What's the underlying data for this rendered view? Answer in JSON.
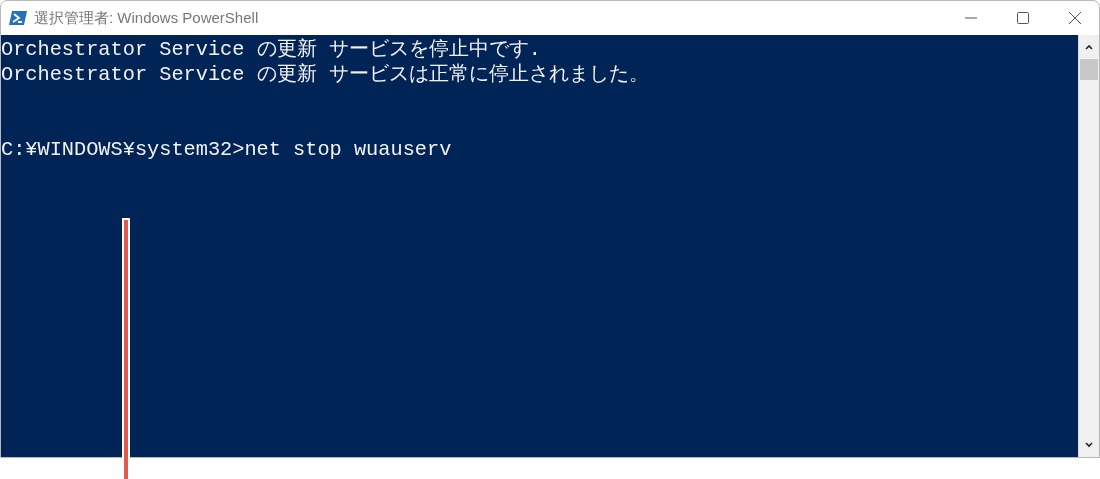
{
  "window": {
    "title": "選択管理者: Windows PowerShell"
  },
  "console": {
    "output": [
      "Orchestrator Service の更新 サービスを停止中です.",
      "Orchestrator Service の更新 サービスは正常に停止されました。"
    ],
    "prompt": "C:¥WINDOWS¥system32>net stop wuauserv"
  },
  "annotation": {
    "kind": "leader-line"
  }
}
